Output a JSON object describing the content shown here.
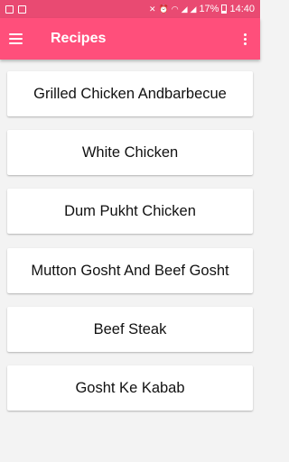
{
  "status_bar": {
    "battery": "17%",
    "time": "14:40"
  },
  "app_bar": {
    "title": "Recipes"
  },
  "recipes": [
    "Grilled Chicken Andbarbecue",
    "White Chicken",
    "Dum Pukht Chicken",
    "Mutton Gosht And Beef Gosht",
    "Beef Steak",
    "Gosht Ke Kabab"
  ],
  "colors": {
    "status_bar": "#e94a72",
    "app_bar": "#ff4f7b",
    "background": "#f3f3f3",
    "card": "#ffffff"
  },
  "icons": {
    "menu": "hamburger-menu-icon",
    "overflow": "more-vert-icon"
  }
}
